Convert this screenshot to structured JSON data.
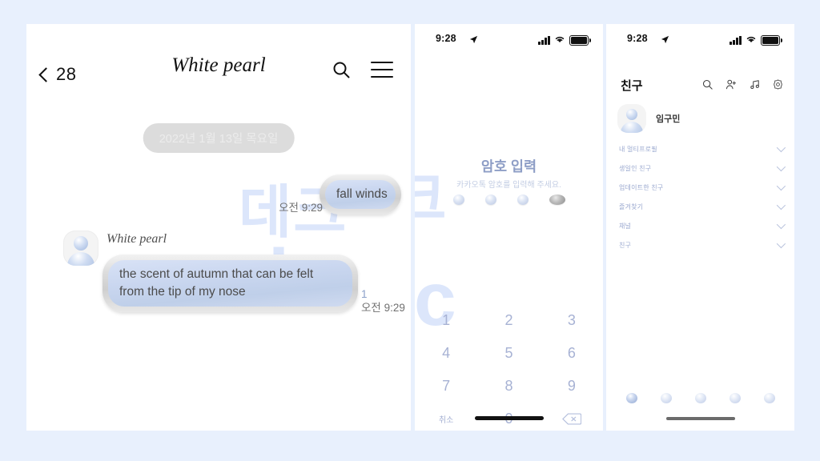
{
  "background_color": "#e8f0fd",
  "chat_panel": {
    "header": {
      "back_count": "28",
      "back_icon": "chevron-left-icon",
      "title": "White pearl",
      "search_icon": "search-icon",
      "menu_icon": "hamburger-menu-icon"
    },
    "date_divider": "2022년 1월 13일 목요일",
    "watermark": {
      "line1": "데크",
      "line2": "abc",
      "color": "#dce6fb"
    },
    "messages": [
      {
        "side": "sent",
        "text": "fall winds",
        "time": "오전 9:29"
      },
      {
        "side": "received",
        "sender": "White pearl",
        "text": "the scent of autumn that can be felt from the tip of my nose",
        "unread_count": "1",
        "time": "오전 9:29"
      }
    ]
  },
  "passcode_panel": {
    "statusbar": {
      "time": "9:28",
      "location_icon": "location-arrow-icon",
      "signal_icon": "cellular-signal-icon",
      "wifi_icon": "wifi-icon",
      "battery_icon": "battery-full-icon"
    },
    "title": "암호 입력",
    "subtitle": "카카오톡 암호를 입력해 주세요.",
    "dots": [
      {
        "state": "empty"
      },
      {
        "state": "empty"
      },
      {
        "state": "empty"
      },
      {
        "state": "filled"
      }
    ],
    "keypad": [
      {
        "label": "1",
        "kind": "digit"
      },
      {
        "label": "2",
        "kind": "digit"
      },
      {
        "label": "3",
        "kind": "digit"
      },
      {
        "label": "4",
        "kind": "digit"
      },
      {
        "label": "5",
        "kind": "digit"
      },
      {
        "label": "6",
        "kind": "digit"
      },
      {
        "label": "7",
        "kind": "digit"
      },
      {
        "label": "8",
        "kind": "digit"
      },
      {
        "label": "9",
        "kind": "digit"
      },
      {
        "label": "취소",
        "kind": "cancel"
      },
      {
        "label": "0",
        "kind": "digit"
      },
      {
        "label": "",
        "kind": "backspace"
      }
    ],
    "home_indicator_color": "#111111"
  },
  "friends_panel": {
    "statusbar": {
      "time": "9:28",
      "location_icon": "location-arrow-icon",
      "signal_icon": "cellular-signal-icon",
      "wifi_icon": "wifi-icon",
      "battery_icon": "battery-full-icon"
    },
    "title": "친구",
    "header_icons": [
      {
        "name": "search-icon"
      },
      {
        "name": "add-friend-icon"
      },
      {
        "name": "music-note-icon"
      },
      {
        "name": "settings-gear-icon"
      }
    ],
    "profile": {
      "name": "임구민",
      "avatar": "default-avatar-icon"
    },
    "sections": [
      {
        "label": "내 멀티프로필"
      },
      {
        "label": "생일인 친구"
      },
      {
        "label": "업데이트한 친구"
      },
      {
        "label": "즐겨찾기"
      },
      {
        "label": "채널"
      },
      {
        "label": "친구"
      }
    ],
    "tabs": [
      {
        "name": "tab-friends",
        "active": true
      },
      {
        "name": "tab-chats",
        "active": false
      },
      {
        "name": "tab-open-chat",
        "active": false
      },
      {
        "name": "tab-shopping",
        "active": false
      },
      {
        "name": "tab-more",
        "active": false
      }
    ],
    "home_indicator_color": "#6b6b6b"
  }
}
